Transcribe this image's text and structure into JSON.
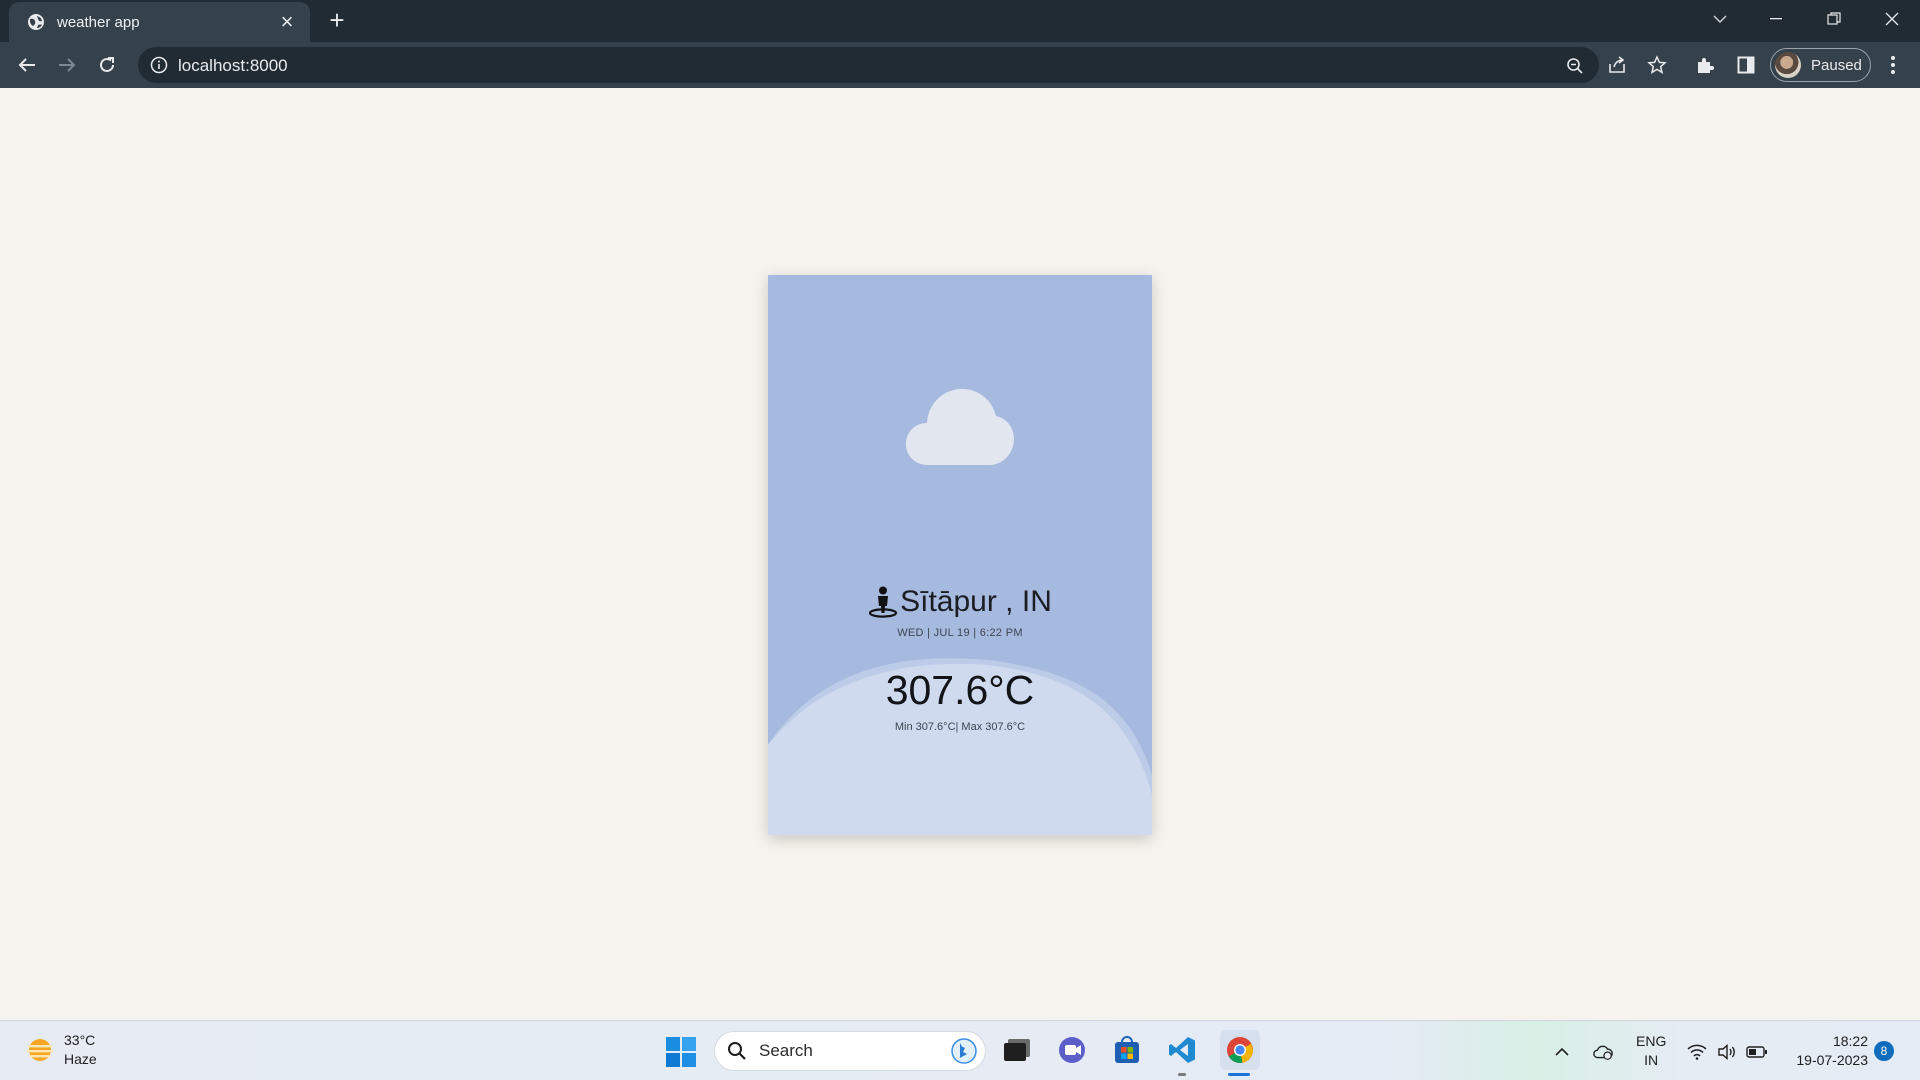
{
  "browser": {
    "tab_title": "weather app",
    "url": "localhost:8000",
    "profile_status": "Paused"
  },
  "weather": {
    "location": "Sītāpur , IN",
    "datetime": "WED | JUL 19 | 6:22 PM",
    "temperature": "307.6°C",
    "min_max": "Min 307.6°C| Max 307.6°C",
    "condition_icon": "cloud-icon",
    "card_color": "#a6b9de"
  },
  "taskbar": {
    "widget_temp": "33°C",
    "widget_condition": "Haze",
    "search_label": "Search",
    "lang_top": "ENG",
    "lang_bottom": "IN",
    "time": "18:22",
    "date": "19-07-2023",
    "notification_count": "8"
  }
}
